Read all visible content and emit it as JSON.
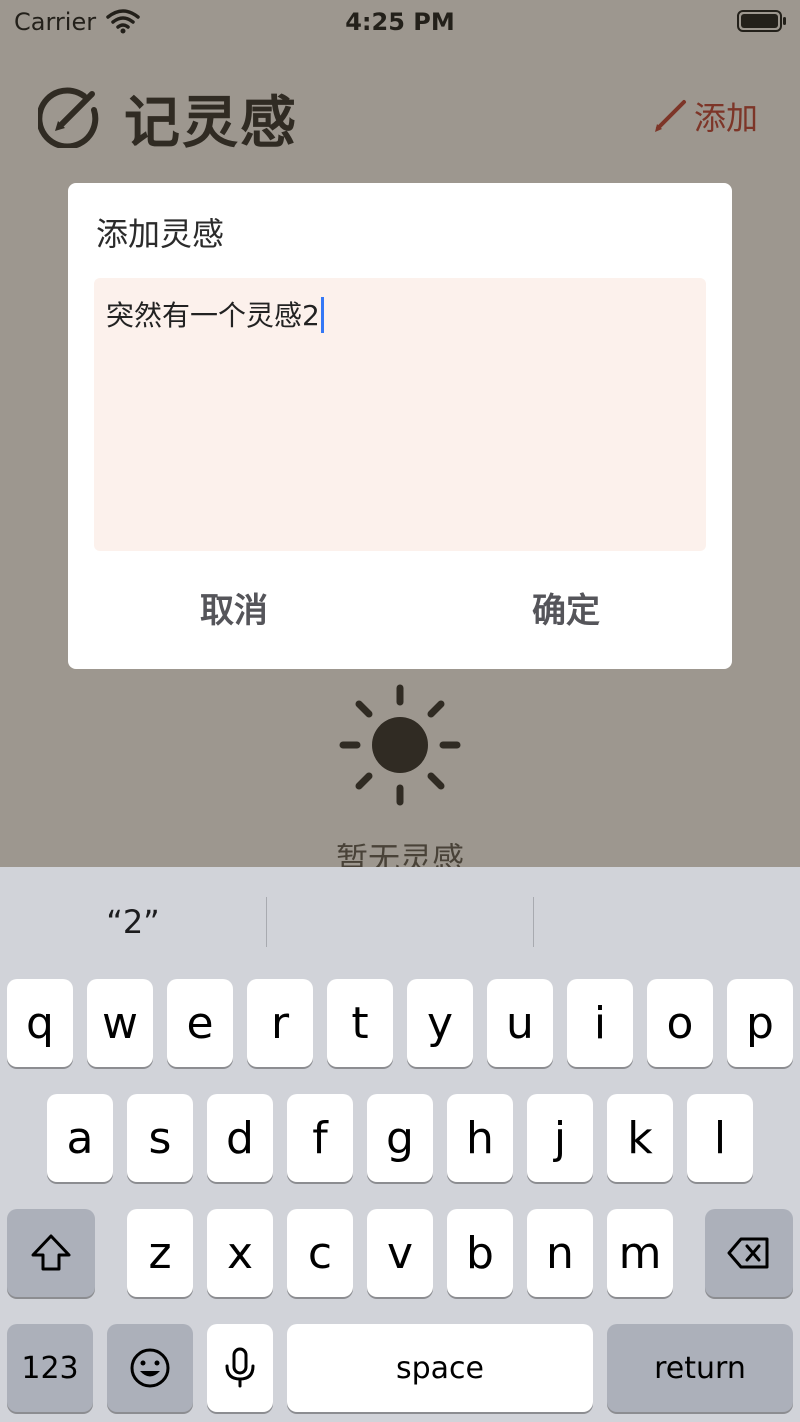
{
  "status_bar": {
    "carrier": "Carrier",
    "time": "4:25 PM"
  },
  "header": {
    "title": "记灵感",
    "add_label": "添加"
  },
  "empty_state": {
    "text": "暂无灵感"
  },
  "dialog": {
    "title": "添加灵感",
    "input_value": "突然有一个灵感2",
    "cancel_label": "取消",
    "confirm_label": "确定"
  },
  "keyboard": {
    "suggestions": [
      "“2”",
      "",
      ""
    ],
    "rows": [
      [
        "q",
        "w",
        "e",
        "r",
        "t",
        "y",
        "u",
        "i",
        "o",
        "p"
      ],
      [
        "a",
        "s",
        "d",
        "f",
        "g",
        "h",
        "j",
        "k",
        "l"
      ],
      [
        "z",
        "x",
        "c",
        "v",
        "b",
        "n",
        "m"
      ]
    ],
    "numbers_label": "123",
    "space_label": "space",
    "return_label": "return"
  },
  "colors": {
    "accent_red": "#c0392b",
    "dialog_input_bg": "#fcf1ec",
    "caret": "#3478f6",
    "keyboard_bg": "#d1d3d9"
  },
  "icons": {
    "logo": "pencil-circle-icon",
    "add": "pencil-icon",
    "empty": "sun-icon",
    "shift": "shift-arrow-icon",
    "delete": "backspace-icon",
    "emoji": "emoji-icon",
    "mic": "microphone-icon"
  }
}
